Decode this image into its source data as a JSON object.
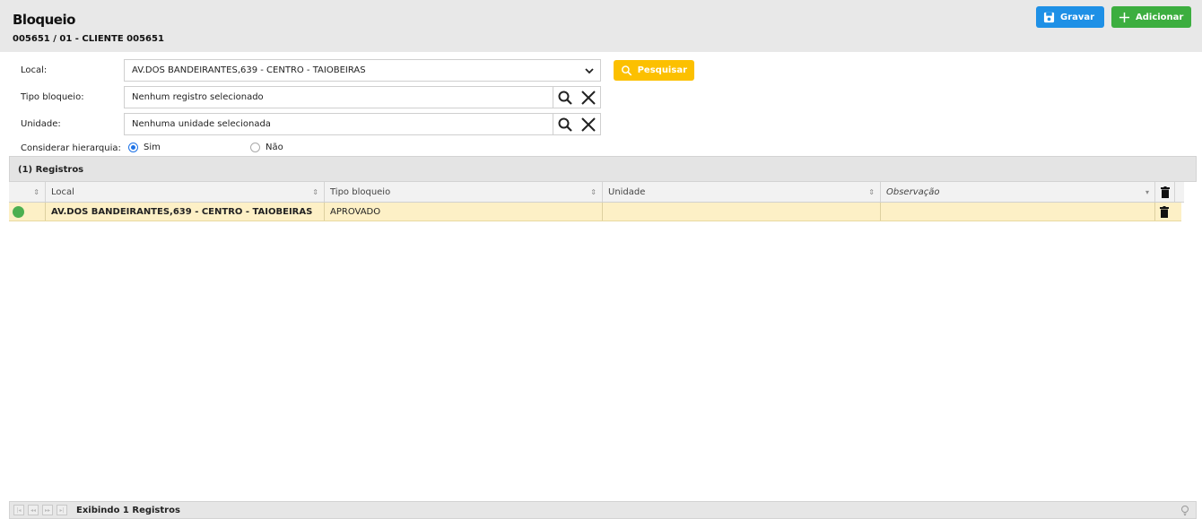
{
  "header": {
    "title": "Bloqueio",
    "subtitle": "005651 / 01 - CLIENTE 005651",
    "save_label": "Gravar",
    "add_label": "Adicionar"
  },
  "form": {
    "local_label": "Local:",
    "local_value": "AV.DOS BANDEIRANTES,639 - CENTRO - TAIOBEIRAS",
    "search_label": "Pesquisar",
    "tipo_label": "Tipo bloqueio:",
    "tipo_value": "Nenhum registro selecionado",
    "unidade_label": "Unidade:",
    "unidade_value": "Nenhuma unidade selecionada",
    "hierarquia_label": "Considerar hierarquia:",
    "option_sim": "Sim",
    "option_nao": "Não",
    "hierarquia_selected": "Sim"
  },
  "registros": {
    "title": "(1) Registros",
    "columns": [
      "Local",
      "Tipo bloqueio",
      "Unidade",
      "Observação"
    ],
    "rows": [
      {
        "status_color": "#4caf50",
        "local": "AV.DOS BANDEIRANTES,639 - CENTRO - TAIOBEIRAS",
        "tipo": "APROVADO",
        "unidade": "",
        "observacao": ""
      }
    ]
  },
  "footer": {
    "text": "Exibindo 1 Registros"
  },
  "colors": {
    "save": "#1e90e6",
    "add": "#3cae3f",
    "search": "#fcc000",
    "row_highlight": "#fdf0c6"
  }
}
